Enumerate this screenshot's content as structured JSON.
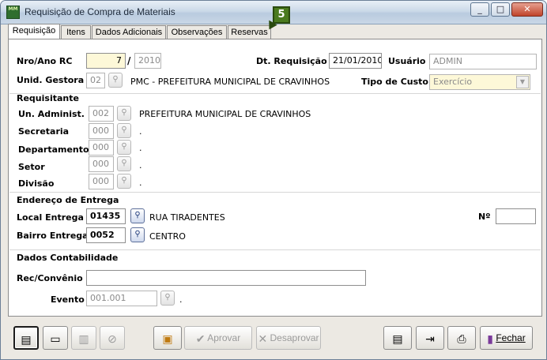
{
  "window": {
    "title": "Requisição de Compra de Materiais",
    "app_icon_text": "MM",
    "controls": [
      "_",
      "□",
      "✕"
    ]
  },
  "tabs": [
    "Requisição",
    "Itens",
    "Dados Adicionais",
    "Observações",
    "Reservas"
  ],
  "annotation_badge": "5",
  "header": {
    "nro_ano_label": "Nro/Ano RC",
    "nro": "7",
    "slash": "/",
    "ano": "2010",
    "dt_requisicao_label": "Dt. Requisição",
    "dt_requisicao": "21/01/2010",
    "usuario_label": "Usuário",
    "usuario": "ADMIN",
    "unid_gestora_label": "Unid. Gestora",
    "unid_gestora_code": "02",
    "unid_gestora_name": "PMC - PREFEITURA MUNICIPAL DE CRAVINHOS",
    "tipo_custo_label": "Tipo de Custo",
    "tipo_custo": "Exercício"
  },
  "requisitante": {
    "title": "Requisitante",
    "rows": [
      {
        "label": "Un. Administ.",
        "code": "002",
        "name": "PREFEITURA MUNICIPAL DE CRAVINHOS"
      },
      {
        "label": "Secretaria",
        "code": "000",
        "name": "."
      },
      {
        "label": "Departamento",
        "code": "000",
        "name": "."
      },
      {
        "label": "Setor",
        "code": "000",
        "name": "."
      },
      {
        "label": "Divisão",
        "code": "000",
        "name": "."
      }
    ]
  },
  "endereco": {
    "title": "Endereço de Entrega",
    "local_label": "Local Entrega",
    "local_code": "01435",
    "local_name": "RUA  TIRADENTES",
    "numero_label": "Nº",
    "numero": "",
    "bairro_label": "Bairro Entrega",
    "bairro_code": "0052",
    "bairro_name": "CENTRO"
  },
  "contabilidade": {
    "title": "Dados Contabilidade",
    "rec_label": "Rec/Convênio",
    "rec_value": "",
    "evento_label": "Evento",
    "evento_code": "001.001",
    "evento_name": "."
  },
  "toolbar": {
    "aprovar": "Aprovar",
    "desaprovar": "Desaprovar",
    "fechar": "Fechar"
  }
}
